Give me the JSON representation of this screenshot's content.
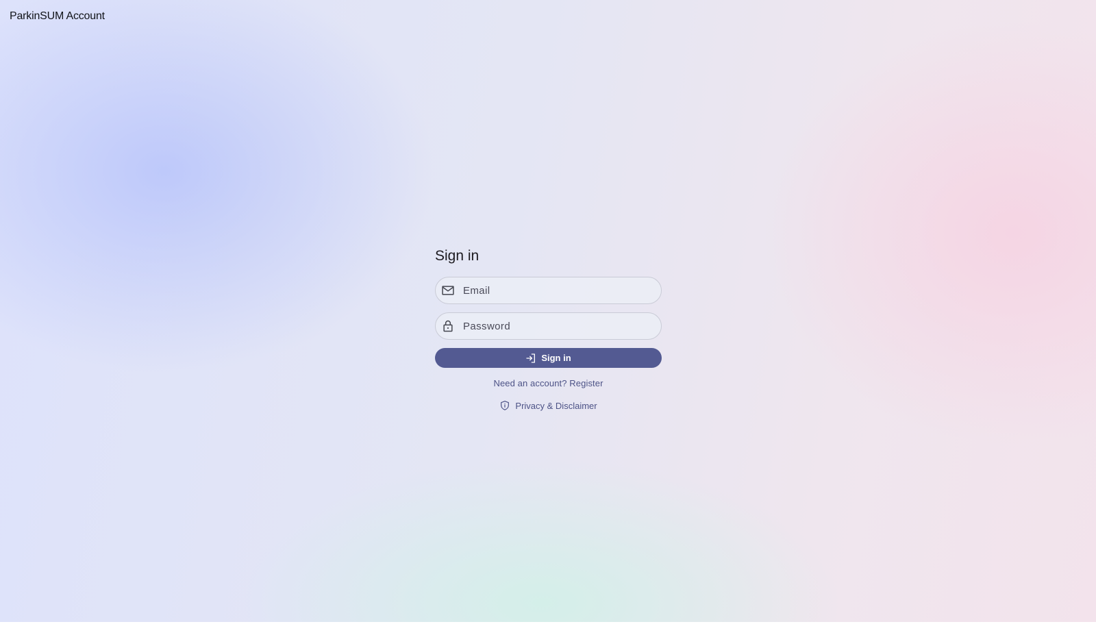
{
  "app": {
    "title": "ParkinSUM Account"
  },
  "signin": {
    "heading": "Sign in",
    "email": {
      "placeholder": "Email",
      "value": "",
      "icon": "mail-icon"
    },
    "password": {
      "placeholder": "Password",
      "value": "",
      "icon": "lock-icon"
    },
    "submit": {
      "label": "Sign in",
      "icon": "login-icon"
    },
    "register_link": "Need an account? Register",
    "privacy_link": {
      "label": "Privacy & Disclaimer",
      "icon": "shield-icon"
    }
  },
  "colors": {
    "primary": "#535a92",
    "link": "#4c5286",
    "text": "#1d1b20",
    "field_border": "#c9cbd6"
  }
}
